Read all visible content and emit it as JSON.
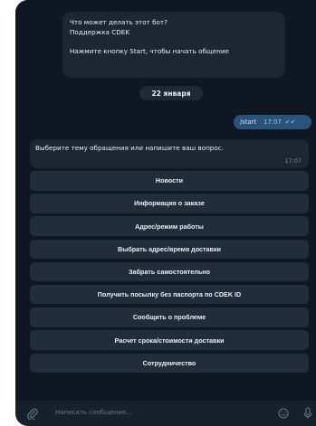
{
  "intro": {
    "line1": "Что может делать этот бот?",
    "line2": "Поддержка CDEK",
    "line3": "Нажмите кнопку Start, чтобы начать общение"
  },
  "date_separator": "22 января",
  "outgoing": {
    "text": "/start",
    "time": "17:07"
  },
  "bot_message": {
    "text": "Выберите тему обращения или напишите ваш вопрос.",
    "time": "17:07"
  },
  "keyboard": [
    "Новости",
    "Информация о заказе",
    "Адрес/режим работы",
    "Выбрать адрес/время доставки",
    "Забрать самостоятельно",
    "Получить посылку без паспорта по CDEK ID",
    "Сообщить о проблеме",
    "Расчет срока/стоимости доставки",
    "Сотрудничество"
  ],
  "composer": {
    "placeholder": "Написать сообщение..."
  },
  "colors": {
    "chat_bg": "#0f1722",
    "bubble_in": "#1d2733",
    "bubble_out": "#2b5278",
    "button": "#222d3b",
    "composer": "#17212b"
  },
  "icons": {
    "attach": "paperclip-icon",
    "emoji": "emoji-icon",
    "mic": "microphone-icon",
    "read": "double-check-icon"
  }
}
